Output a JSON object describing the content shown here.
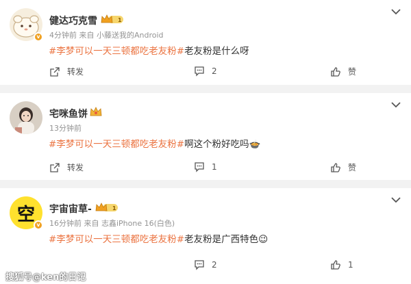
{
  "comments": [
    {
      "username": "健达巧克雪",
      "level_badge": "1",
      "verified_mark": "v",
      "meta": "4分钟前   来自 小藤送我的Android",
      "hashtag": "#李梦可以一天三顿都吃老友粉#",
      "text": "老友粉是什么呀",
      "emoji": "",
      "repost_label": "转发",
      "comment_count": "2",
      "like_label": "赞",
      "icons": {
        "menu": "chevron-down-icon",
        "repost": "repost-icon",
        "comment": "comment-icon",
        "like": "thumbs-up-icon"
      }
    },
    {
      "username": "宅咪鱼饼",
      "level_badge": "",
      "verified_mark": "",
      "meta": "13分钟前",
      "hashtag": "#李梦可以一天三顿都吃老友粉#",
      "text": "啊这个粉好吃吗",
      "emoji": "🍲",
      "repost_label": "转发",
      "comment_count": "1",
      "like_label": "赞",
      "icons": {
        "menu": "chevron-down-icon",
        "repost": "repost-icon",
        "comment": "comment-icon",
        "like": "thumbs-up-icon"
      }
    },
    {
      "username": "宇宙宙草-",
      "avatar_text": "空",
      "level_badge": "1",
      "verified_mark": "v",
      "meta": "16分钟前   来自 志鑫iPhone 16(白色)",
      "hashtag": "#李梦可以一天三顿都吃老友粉#",
      "text": "老友粉是广西特色",
      "emoji": "😉",
      "repost_label": "转发",
      "comment_count": "2",
      "like_count": "1",
      "icons": {
        "menu": "chevron-down-icon",
        "repost": "repost-icon",
        "comment": "comment-icon",
        "like": "thumbs-up-icon"
      }
    }
  ],
  "watermark": "搜狐号@ken的日记",
  "colors": {
    "hashtag": "#eb7340",
    "meta": "#939393",
    "verified": "#f0a020",
    "page_bg": "#f2f2f2"
  }
}
